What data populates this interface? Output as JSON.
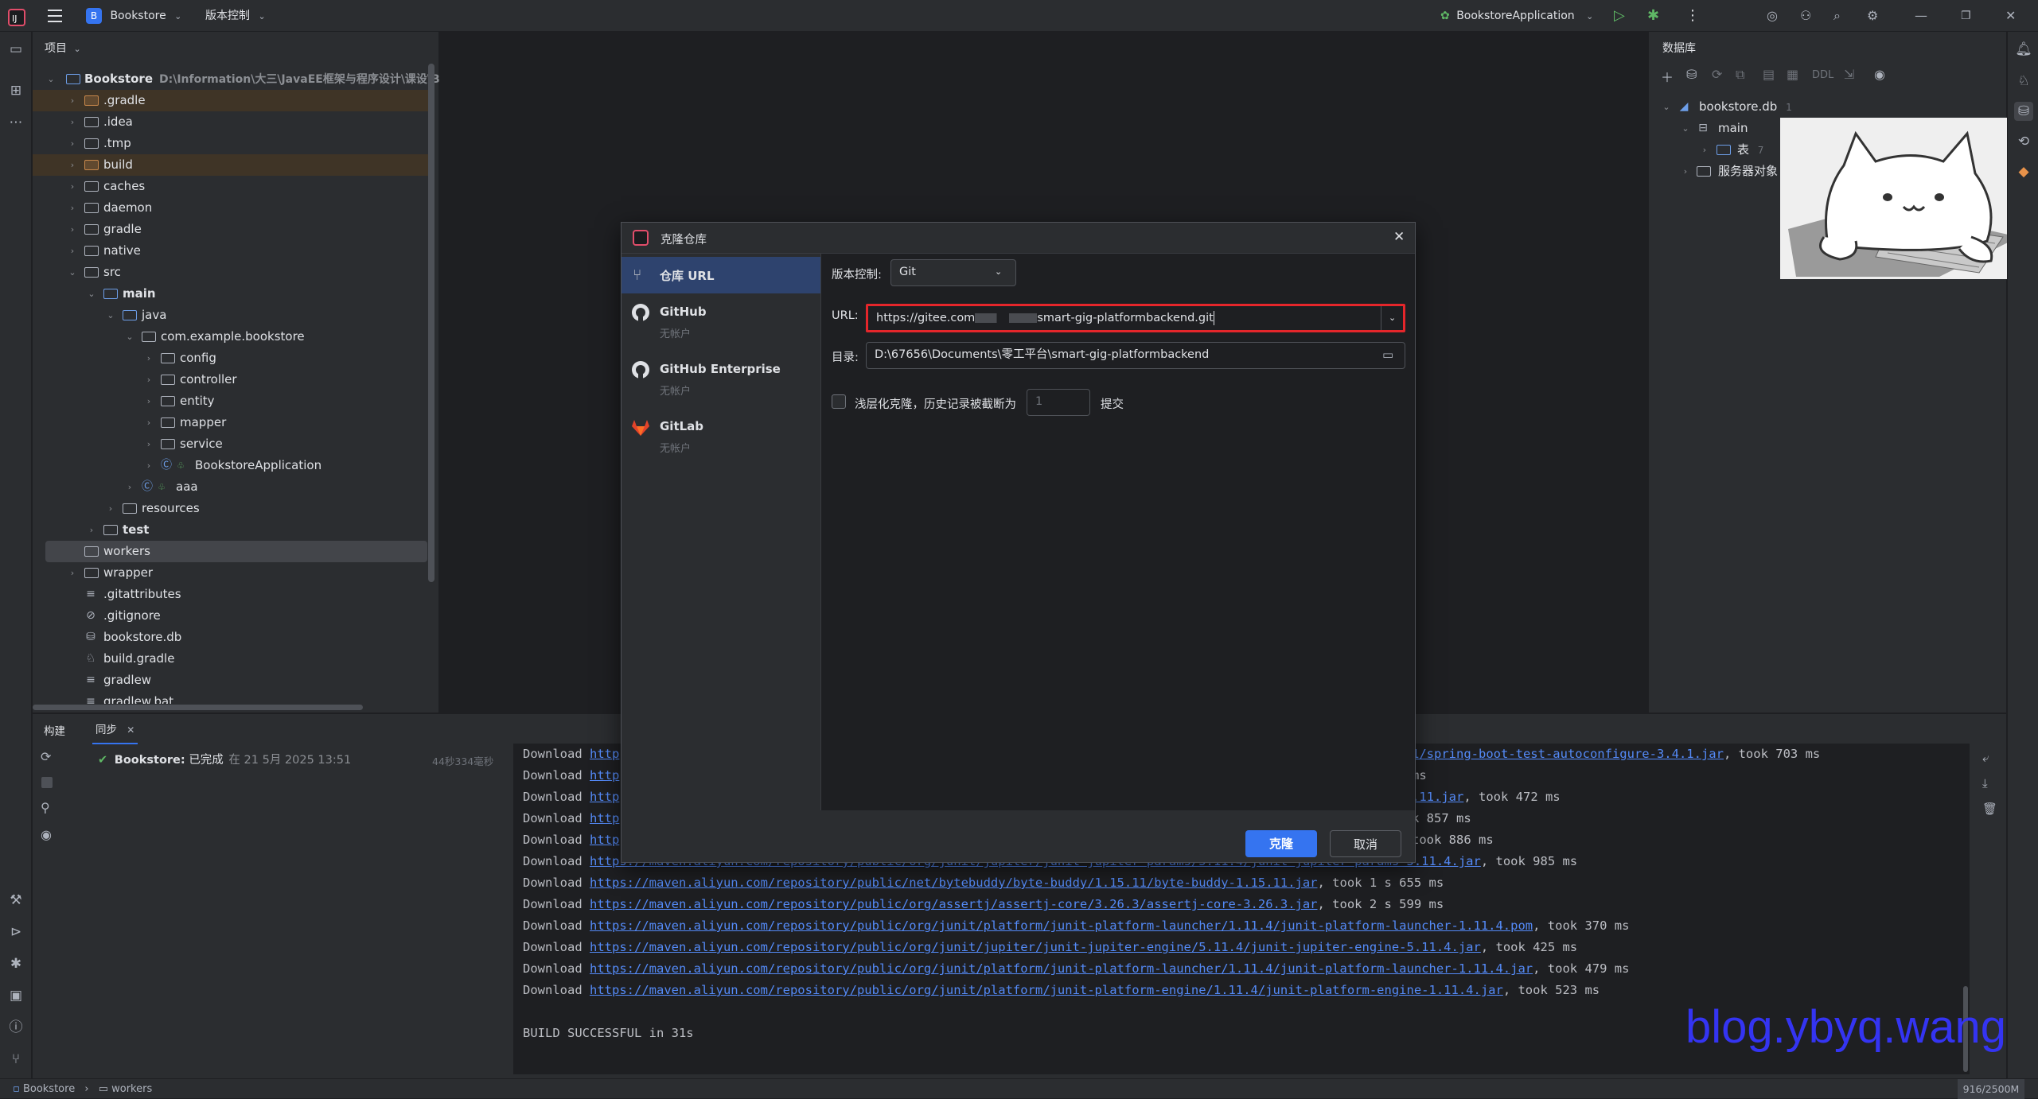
{
  "titlebar": {
    "project_badge": "B",
    "project_name": "Bookstore",
    "vcs_menu": "版本控制",
    "run_config": "BookstoreApplication"
  },
  "project_panel": {
    "header": "项目",
    "root_name": "Bookstore",
    "root_path": "D:\\Information\\大三\\JavaEE框架与程序设计\\课设\\Bo",
    "items": [
      {
        "label": ".gradle"
      },
      {
        "label": ".idea"
      },
      {
        "label": ".tmp"
      },
      {
        "label": "build"
      },
      {
        "label": "caches"
      },
      {
        "label": "daemon"
      },
      {
        "label": "gradle"
      },
      {
        "label": "native"
      },
      {
        "label": "src"
      },
      {
        "label": "main"
      },
      {
        "label": "java"
      },
      {
        "label": "com.example.bookstore"
      },
      {
        "label": "config"
      },
      {
        "label": "controller"
      },
      {
        "label": "entity"
      },
      {
        "label": "mapper"
      },
      {
        "label": "service"
      },
      {
        "label": "BookstoreApplication"
      },
      {
        "label": "aaa"
      },
      {
        "label": "resources"
      },
      {
        "label": "test"
      },
      {
        "label": "workers"
      },
      {
        "label": "wrapper"
      },
      {
        "label": ".gitattributes"
      },
      {
        "label": ".gitignore"
      },
      {
        "label": "bookstore.db"
      },
      {
        "label": "build.gradle"
      },
      {
        "label": "gradlew"
      },
      {
        "label": "gradlew.bat"
      }
    ]
  },
  "database_panel": {
    "header": "数据库",
    "toolbar_ddl": "DDL",
    "db_name": "bookstore.db",
    "db_count": "1",
    "schema": "main",
    "tables_label": "表",
    "tables_count": "7",
    "server_objects": "服务器对象"
  },
  "dialog": {
    "title": "克隆仓库",
    "sources": [
      {
        "name": "仓库 URL",
        "sub": ""
      },
      {
        "name": "GitHub",
        "sub": "无帐户"
      },
      {
        "name": "GitHub Enterprise",
        "sub": "无帐户"
      },
      {
        "name": "GitLab",
        "sub": "无帐户"
      }
    ],
    "vcs_label": "版本控制:",
    "vcs_value": "Git",
    "url_label": "URL:",
    "url_prefix": "https://gitee.com",
    "url_suffix": "smart-gig-platformbackend.git",
    "dir_label": "目录:",
    "dir_value": "D:\\67656\\Documents\\零工平台\\smart-gig-platformbackend",
    "shallow_label": "浅层化克隆，历史记录被截断为",
    "shallow_value": "1",
    "shallow_unit": "提交",
    "clone_button": "克隆",
    "cancel_button": "取消",
    "accent": "#3574f0",
    "highlight": "#e5262b"
  },
  "build_panel": {
    "tab_build": "构建",
    "tab_sync": "同步",
    "task_name": "Bookstore:",
    "task_status": "已完成",
    "task_time": "在 21 5月 2025 13:51",
    "task_duration": "44秒334毫秒",
    "console": [
      {
        "pre": "Download ",
        "link": "http",
        "post": "",
        "tail_link": "1/spring-boot-test-autoconfigure-3.4.1.jar",
        "tail": ", took 703 ms"
      },
      {
        "pre": "Download ",
        "link": "http",
        "post": "",
        "tail_link": "",
        "tail": "ms"
      },
      {
        "pre": "Download ",
        "link": "http",
        "post": "",
        "tail_link": ".11.jar",
        "tail": ", took 472 ms"
      },
      {
        "pre": "Download ",
        "link": "http",
        "post": "",
        "tail_link": "",
        "tail": "k 857 ms"
      },
      {
        "pre": "Download ",
        "link": "http",
        "post": "",
        "tail_link": "",
        "tail": " took 886 ms"
      },
      {
        "pre": "Download ",
        "link": "https://maven.aliyun.com/repository/public/org/junit/jupiter/junit-jupiter-params/5.11.4/junit-jupiter-params-5.11.4.jar",
        "post": ", took 985 ms"
      },
      {
        "pre": "Download ",
        "link": "https://maven.aliyun.com/repository/public/net/bytebuddy/byte-buddy/1.15.11/byte-buddy-1.15.11.jar",
        "post": ", took 1 s 655 ms"
      },
      {
        "pre": "Download ",
        "link": "https://maven.aliyun.com/repository/public/org/assertj/assertj-core/3.26.3/assertj-core-3.26.3.jar",
        "post": ", took 2 s 599 ms"
      },
      {
        "pre": "Download ",
        "link": "https://maven.aliyun.com/repository/public/org/junit/platform/junit-platform-launcher/1.11.4/junit-platform-launcher-1.11.4.pom",
        "post": ", took 370 ms"
      },
      {
        "pre": "Download ",
        "link": "https://maven.aliyun.com/repository/public/org/junit/jupiter/junit-jupiter-engine/5.11.4/junit-jupiter-engine-5.11.4.jar",
        "post": ", took 425 ms"
      },
      {
        "pre": "Download ",
        "link": "https://maven.aliyun.com/repository/public/org/junit/platform/junit-platform-launcher/1.11.4/junit-platform-launcher-1.11.4.jar",
        "post": ", took 479 ms"
      },
      {
        "pre": "Download ",
        "link": "https://maven.aliyun.com/repository/public/org/junit/platform/junit-platform-engine/1.11.4/junit-platform-engine-1.11.4.jar",
        "post": ", took 523 ms"
      }
    ],
    "build_result": "BUILD SUCCESSFUL in 31s"
  },
  "statusbar": {
    "crumb_project": "Bookstore",
    "crumb_folder": "workers",
    "memory": "916/2500M"
  },
  "watermark": "blog.ybyq.wang"
}
